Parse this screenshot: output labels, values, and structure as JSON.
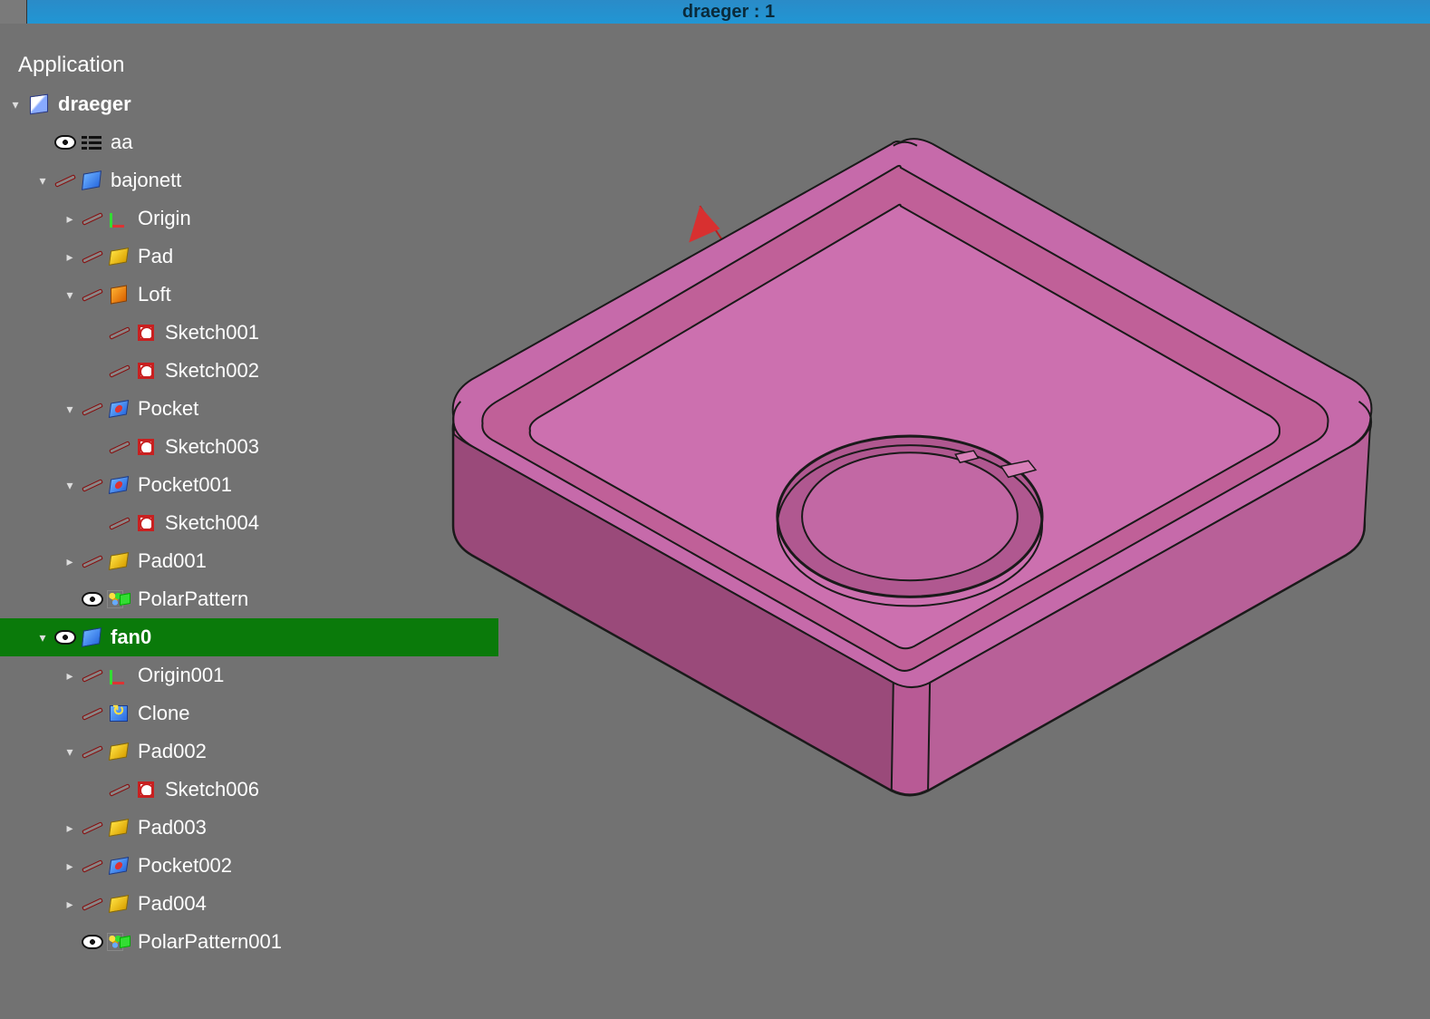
{
  "window": {
    "title": "draeger : 1"
  },
  "tree": {
    "header": "Application",
    "nodes": [
      {
        "depth": 0,
        "expand": "open",
        "vis": null,
        "icon": "doc",
        "label": "draeger",
        "bold": true,
        "selected": false
      },
      {
        "depth": 1,
        "expand": "none",
        "vis": "open",
        "icon": "list",
        "label": "aa",
        "bold": false,
        "selected": false
      },
      {
        "depth": 1,
        "expand": "open",
        "vis": "closed",
        "icon": "body",
        "label": "bajonett",
        "bold": false,
        "selected": false
      },
      {
        "depth": 2,
        "expand": "closed",
        "vis": "closed",
        "icon": "origin",
        "label": "Origin",
        "bold": false,
        "selected": false
      },
      {
        "depth": 2,
        "expand": "closed",
        "vis": "closed",
        "icon": "pad",
        "label": "Pad",
        "bold": false,
        "selected": false
      },
      {
        "depth": 2,
        "expand": "open",
        "vis": "closed",
        "icon": "loft",
        "label": "Loft",
        "bold": false,
        "selected": false
      },
      {
        "depth": 3,
        "expand": "none",
        "vis": "closed",
        "icon": "sketch",
        "label": "Sketch001",
        "bold": false,
        "selected": false
      },
      {
        "depth": 3,
        "expand": "none",
        "vis": "closed",
        "icon": "sketch",
        "label": "Sketch002",
        "bold": false,
        "selected": false
      },
      {
        "depth": 2,
        "expand": "open",
        "vis": "closed",
        "icon": "pocket",
        "label": "Pocket",
        "bold": false,
        "selected": false
      },
      {
        "depth": 3,
        "expand": "none",
        "vis": "closed",
        "icon": "sketch",
        "label": "Sketch003",
        "bold": false,
        "selected": false
      },
      {
        "depth": 2,
        "expand": "open",
        "vis": "closed",
        "icon": "pocket",
        "label": "Pocket001",
        "bold": false,
        "selected": false
      },
      {
        "depth": 3,
        "expand": "none",
        "vis": "closed",
        "icon": "sketch",
        "label": "Sketch004",
        "bold": false,
        "selected": false
      },
      {
        "depth": 2,
        "expand": "closed",
        "vis": "closed",
        "icon": "pad",
        "label": "Pad001",
        "bold": false,
        "selected": false
      },
      {
        "depth": 2,
        "expand": "none",
        "vis": "open",
        "icon": "polar",
        "label": "PolarPattern",
        "bold": false,
        "selected": false
      },
      {
        "depth": 1,
        "expand": "open",
        "vis": "open",
        "icon": "body",
        "label": "fan0",
        "bold": true,
        "selected": true
      },
      {
        "depth": 2,
        "expand": "closed",
        "vis": "closed",
        "icon": "origin",
        "label": "Origin001",
        "bold": false,
        "selected": false
      },
      {
        "depth": 2,
        "expand": "none",
        "vis": "closed",
        "icon": "clone",
        "label": "Clone",
        "bold": false,
        "selected": false
      },
      {
        "depth": 2,
        "expand": "open",
        "vis": "closed",
        "icon": "pad",
        "label": "Pad002",
        "bold": false,
        "selected": false
      },
      {
        "depth": 3,
        "expand": "none",
        "vis": "closed",
        "icon": "sketch",
        "label": "Sketch006",
        "bold": false,
        "selected": false
      },
      {
        "depth": 2,
        "expand": "closed",
        "vis": "closed",
        "icon": "pad",
        "label": "Pad003",
        "bold": false,
        "selected": false
      },
      {
        "depth": 2,
        "expand": "closed",
        "vis": "closed",
        "icon": "pocket",
        "label": "Pocket002",
        "bold": false,
        "selected": false
      },
      {
        "depth": 2,
        "expand": "closed",
        "vis": "closed",
        "icon": "pad",
        "label": "Pad004",
        "bold": false,
        "selected": false
      },
      {
        "depth": 2,
        "expand": "none",
        "vis": "open",
        "icon": "polar",
        "label": "PolarPattern001",
        "bold": false,
        "selected": false
      }
    ]
  },
  "colors": {
    "background": "#727272",
    "selected_bg": "#0a7a0a",
    "titlebar_blue": "#2196d4",
    "model_face": "#c668a8",
    "model_edge": "#1a1a1a",
    "axis_x": "#d83030",
    "axis_y": "#30c830",
    "axis_z": "#3050d0"
  }
}
